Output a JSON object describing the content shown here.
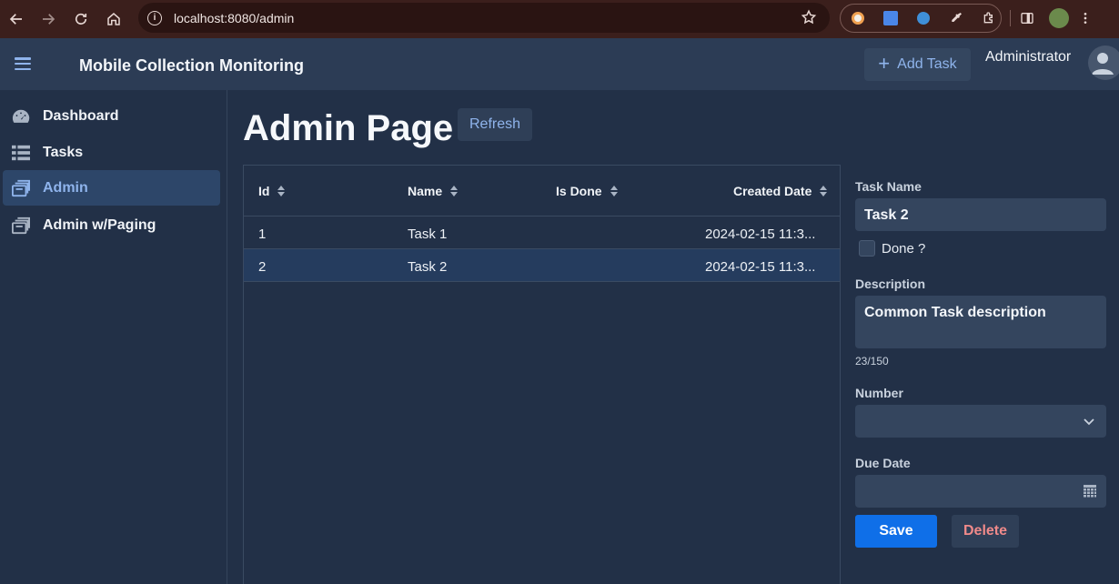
{
  "browser": {
    "url": "localhost:8080/admin",
    "back_icon": "arrow-left-icon",
    "forward_icon": "arrow-right-icon",
    "reload_icon": "reload-icon",
    "home_icon": "home-icon"
  },
  "header": {
    "title": "Mobile Collection Monitoring",
    "add_task_label": "Add Task",
    "user_name": "Administrator"
  },
  "sidebar": {
    "items": [
      {
        "label": "Dashboard",
        "icon": "gauge-icon",
        "active": false
      },
      {
        "label": "Tasks",
        "icon": "list-icon",
        "active": false
      },
      {
        "label": "Admin",
        "icon": "archive-icon",
        "active": true
      },
      {
        "label": "Admin w/Paging",
        "icon": "archive-icon",
        "active": false
      }
    ]
  },
  "main": {
    "title": "Admin Page",
    "refresh_label": "Refresh"
  },
  "grid": {
    "columns": [
      "Id",
      "Name",
      "Is Done",
      "Created Date"
    ],
    "rows": [
      {
        "id": "1",
        "name": "Task 1",
        "is_done": "",
        "created": "2024-02-15 11:3..."
      },
      {
        "id": "2",
        "name": "Task 2",
        "is_done": "",
        "created": "2024-02-15 11:3...",
        "selected": true
      }
    ]
  },
  "form": {
    "task_name_label": "Task Name",
    "task_name_value": "Task 2",
    "done_label": "Done ?",
    "description_label": "Description",
    "description_value": "Common Task description",
    "description_counter": "23/150",
    "number_label": "Number",
    "number_value": "",
    "due_date_label": "Due Date",
    "due_date_value": "",
    "save_label": "Save",
    "delete_label": "Delete"
  },
  "colors": {
    "accent": "#8fb4ec",
    "primary_button": "#0f6fe8",
    "danger_text": "#f08a8a",
    "background": "#223047"
  }
}
